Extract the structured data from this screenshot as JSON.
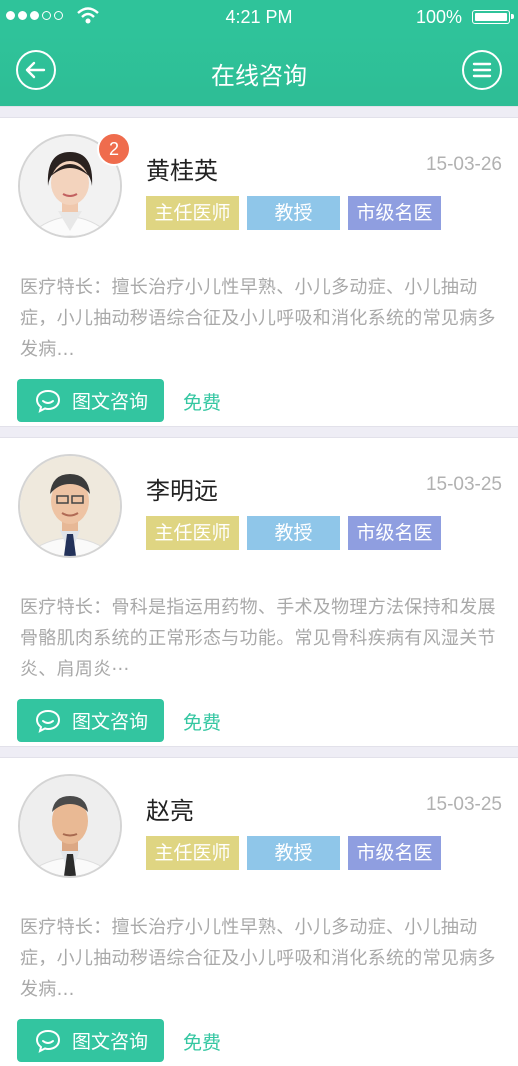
{
  "status_bar": {
    "time": "4:21 PM",
    "battery": "100%"
  },
  "nav": {
    "title": "在线咨询"
  },
  "doctors": [
    {
      "name": "黄桂英",
      "date": "15-03-26",
      "badge": "2",
      "tags": [
        "主任医师",
        "教授",
        "市级名医"
      ],
      "description": "医疗特长：擅长治疗小儿性早熟、小儿多动症、小儿抽动症，小儿抽动秽语综合征及小儿呼吸和消化系统的常见病多发病...",
      "consult_label": "图文咨询",
      "price": "免费"
    },
    {
      "name": "李明远",
      "date": "15-03-25",
      "tags": [
        "主任医师",
        "教授",
        "市级名医"
      ],
      "description": "医疗特长：骨科是指运用药物、手术及物理方法保持和发展骨骼肌肉系统的正常形态与功能。常见骨科疾病有风湿关节炎、肩周炎···",
      "consult_label": "图文咨询",
      "price": "免费"
    },
    {
      "name": "赵亮",
      "date": "15-03-25",
      "tags": [
        "主任医师",
        "教授",
        "市级名医"
      ],
      "description": "医疗特长：擅长治疗小儿性早熟、小儿多动症、小儿抽动症，小儿抽动秽语综合征及小儿呼吸和消化系统的常见病多发病...",
      "consult_label": "图文咨询",
      "price": "免费"
    }
  ],
  "colors": {
    "primary": "#2fc39a",
    "badge": "#ef6c4d",
    "tag_title": "#dfd582",
    "tag_professor": "#8fc6e9",
    "tag_famous": "#8f9ee0"
  }
}
